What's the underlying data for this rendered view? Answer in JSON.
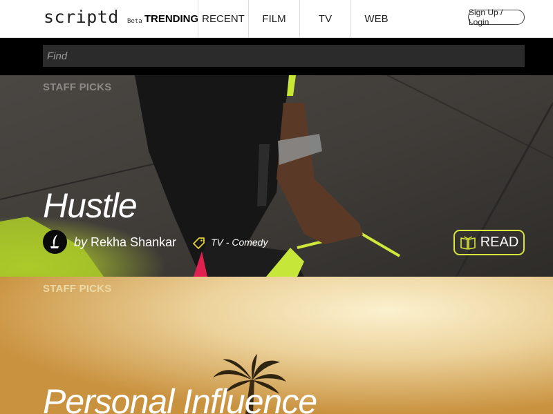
{
  "brand": {
    "name": "scriptd",
    "badge": "Beta"
  },
  "nav": [
    {
      "label": "TRENDING",
      "active": true
    },
    {
      "label": "RECENT",
      "active": false
    },
    {
      "label": "FILM",
      "active": false
    },
    {
      "label": "TV",
      "active": false
    },
    {
      "label": "WEB",
      "active": false
    }
  ],
  "auth": {
    "label": "Sign Up / Login"
  },
  "search": {
    "placeholder": "Find",
    "value": ""
  },
  "cards": [
    {
      "section_label": "STAFF PICKS",
      "title": "Hustle",
      "author_prefix": "by",
      "author_name": "Rekha Shankar",
      "genre": "TV - Comedy",
      "read_label": "READ"
    },
    {
      "section_label": "STAFF PICKS",
      "title": "Personal Influence"
    }
  ],
  "colors": {
    "accent": "#d8e63c",
    "search_bg": "#2b2b2b",
    "genre_tag": "#e8d23a"
  },
  "icons": [
    "quill-pen-icon",
    "tag-icon",
    "open-book-icon"
  ]
}
